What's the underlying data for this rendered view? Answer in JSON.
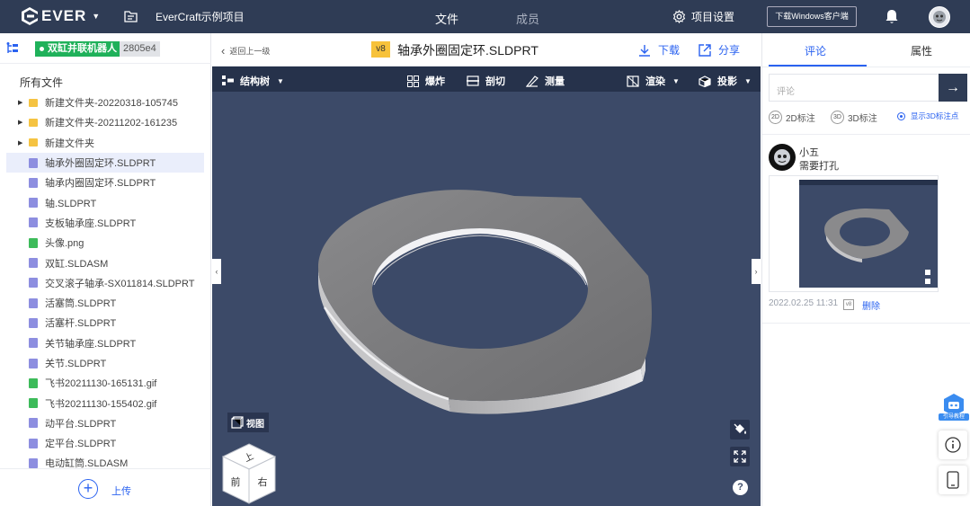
{
  "topbar": {
    "brand": "EVER",
    "project": "EverCraft示例项目",
    "tabs": [
      "文件",
      "成员"
    ],
    "settings": "项目设置",
    "download_client": "下载Windows客户端",
    "colors": {
      "bg": "#2f3c55",
      "accent": "#2a62f0"
    }
  },
  "left": {
    "robot_label": "双缸并联机器人",
    "robot_code": "2805e4",
    "all_files": "所有文件",
    "files": [
      {
        "name": "新建文件夹-20220318-105745",
        "type": "folder",
        "icon": "folder-icon"
      },
      {
        "name": "新建文件夹-20211202-161235",
        "type": "folder",
        "icon": "folder-icon"
      },
      {
        "name": "新建文件夹",
        "type": "folder",
        "icon": "folder-icon"
      },
      {
        "name": "轴承外圈固定环.SLDPRT",
        "type": "part",
        "icon": "file-icon",
        "selected": true
      },
      {
        "name": "轴承内圈固定环.SLDPRT",
        "type": "part",
        "icon": "file-icon"
      },
      {
        "name": "轴.SLDPRT",
        "type": "part",
        "icon": "file-icon"
      },
      {
        "name": "支板轴承座.SLDPRT",
        "type": "part",
        "icon": "file-icon"
      },
      {
        "name": "头像.png",
        "type": "image",
        "icon": "image-file-icon"
      },
      {
        "name": "双缸.SLDASM",
        "type": "part",
        "icon": "file-icon"
      },
      {
        "name": "交叉滚子轴承-SX011814.SLDPRT",
        "type": "part",
        "icon": "file-icon"
      },
      {
        "name": "活塞筒.SLDPRT",
        "type": "part",
        "icon": "file-icon"
      },
      {
        "name": "活塞杆.SLDPRT",
        "type": "part",
        "icon": "file-icon"
      },
      {
        "name": "关节轴承座.SLDPRT",
        "type": "part",
        "icon": "file-icon"
      },
      {
        "name": "关节.SLDPRT",
        "type": "part",
        "icon": "file-icon"
      },
      {
        "name": "飞书20211130-165131.gif",
        "type": "image",
        "icon": "image-file-icon"
      },
      {
        "name": "飞书20211130-155402.gif",
        "type": "image",
        "icon": "image-file-icon"
      },
      {
        "name": "动平台.SLDPRT",
        "type": "part",
        "icon": "file-icon"
      },
      {
        "name": "定平台.SLDPRT",
        "type": "part",
        "icon": "file-icon"
      },
      {
        "name": "电动缸筒.SLDASM",
        "type": "part",
        "icon": "file-icon"
      }
    ],
    "upload": "上传"
  },
  "center": {
    "back": "返回上一级",
    "version": "v8",
    "filename": "轴承外圈固定环.SLDPRT",
    "download": "下载",
    "share": "分享",
    "tools": {
      "tree": "结构树",
      "explode": "爆炸",
      "section": "剖切",
      "measure": "测量",
      "render": "渲染",
      "projection": "投影"
    },
    "view_button": "视图",
    "cube_faces": {
      "top": "上",
      "front": "前",
      "right": "右"
    },
    "help": "?"
  },
  "right": {
    "tabs": [
      "评论",
      "属性"
    ],
    "comment_placeholder": "评论",
    "mode_2d": "2D标注",
    "mode_3d": "3D标注",
    "mode_2d_icon": "2D",
    "mode_3d_icon": "3D",
    "show_3d": "显示3D标注点",
    "comment": {
      "user": "小五",
      "text": "需要打孔",
      "time": "2022.02.25 11:31",
      "version": "v8",
      "delete": "删除"
    },
    "guide": "引导教程"
  }
}
